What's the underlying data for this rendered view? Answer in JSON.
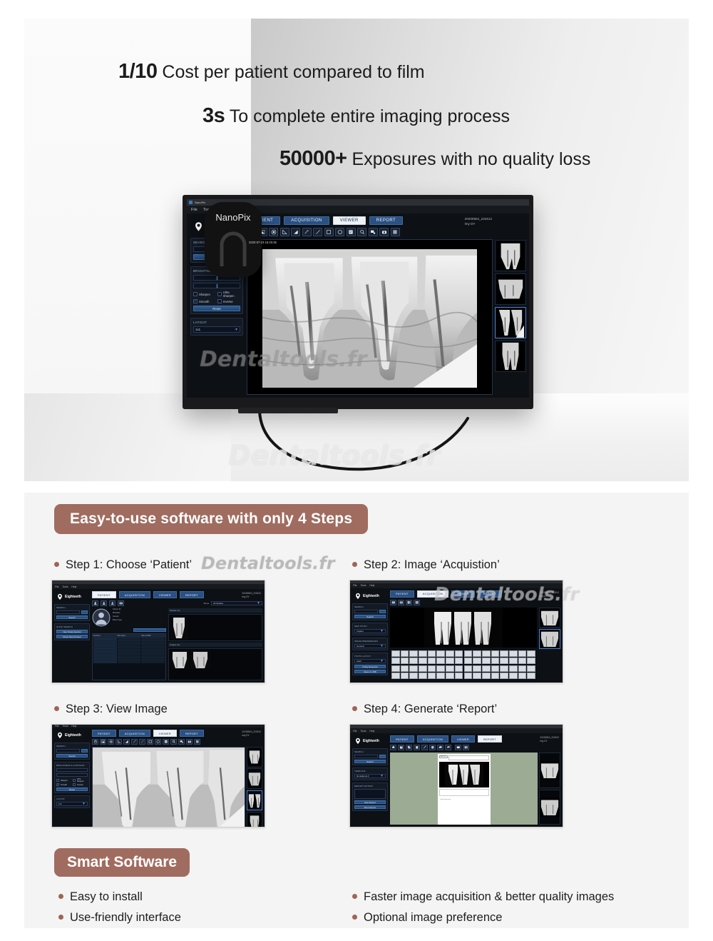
{
  "hero": {
    "stats": [
      {
        "number": "1/10",
        "text": "Cost per patient compared to film"
      },
      {
        "number": "3s",
        "text": "To complete entire imaging process"
      },
      {
        "number": "50000+",
        "text": "Exposures with no quality loss"
      }
    ],
    "sensor_label": "NanoPix",
    "watermark": "Dentaltools.fr"
  },
  "app": {
    "window_title": "NanoPix",
    "menus": [
      "File",
      "Tools",
      "Help"
    ],
    "brand": "Eighteeth",
    "tabs": [
      {
        "label": "PATIENT",
        "active": false
      },
      {
        "label": "ACQUISITION",
        "active": false
      },
      {
        "label": "VIEWER",
        "active": true
      },
      {
        "label": "REPORT",
        "active": false
      }
    ],
    "header_id": "20200804_222612",
    "header_sub": "lmy DY",
    "image_timestamp": "2020-07-23 15:20:35",
    "toolbar_icons": [
      "hand-icon",
      "contrast-icon",
      "brightness-icon",
      "angle-icon",
      "triangle-icon",
      "pen-icon",
      "line-icon",
      "rectangle-icon",
      "ellipse-icon",
      "note-icon",
      "magnifier-icon",
      "stamp-icon",
      "camera-icon",
      "grid-icon"
    ],
    "panels": {
      "search": {
        "title": "SEARCH",
        "input_value": "",
        "dropdown_label": "▾",
        "button": "Search"
      },
      "brightness": {
        "title": "BRIGHTNESS & CONTRAST",
        "checkboxes": [
          {
            "label": "Sharpen",
            "checked": false
          },
          {
            "label": "Ultra Sharpen",
            "checked": false
          },
          {
            "label": "Smooth",
            "checked": true
          },
          {
            "label": "Inverse",
            "checked": false
          }
        ],
        "reset": "Reset"
      },
      "layout": {
        "title": "LAYOUT",
        "value": "1x1"
      }
    }
  },
  "steps_section": {
    "heading": "Easy-to-use software with only 4 Steps",
    "steps": [
      {
        "label": "Step 1: Choose ‘Patient’",
        "active_tab": "PATIENT"
      },
      {
        "label": "Step 2: Image ‘Acquistion’",
        "active_tab": "ACQUISITION"
      },
      {
        "label": "Step 3: View Image",
        "active_tab": "VIEWER"
      },
      {
        "label": "Step 4: Generate ‘Report’",
        "active_tab": "REPORT"
      }
    ]
  },
  "step1": {
    "panels": [
      {
        "title": "SEARCH",
        "button": "Search"
      },
      {
        "title": "QUICK SEARCH",
        "buttons": [
          "New Study Appoint",
          "Show New Present"
        ]
      }
    ],
    "filter_label": "Show",
    "filter_value": "All Studies",
    "info_labels": [
      "Patient ID",
      "Birthdate",
      "Gender",
      "Blood Type",
      "Date of Birth"
    ],
    "table_headers": [
      "Surname",
      "First name",
      "Date of Birth"
    ],
    "studies_title": "Studies List",
    "images_title": "Images List"
  },
  "step2": {
    "panels": [
      {
        "title": "SEARCH",
        "button": "Search"
      },
      {
        "title": "NEW STUDY",
        "value": "Implant"
      },
      {
        "title": "IMAGE PREFERENCES",
        "value": "General"
      },
      {
        "title": "TOOTH LAYOUT",
        "value": "Adult"
      }
    ],
    "buttons": [
      "X-Ray Exposure",
      "Save to USB"
    ],
    "toolbar_icons": [
      "import-icon",
      "export-icon",
      "split-view-icon",
      "layout-icon"
    ]
  },
  "step4": {
    "panels": [
      {
        "title": "SEARCH",
        "button": "Search"
      },
      {
        "title": "TEMPLATE",
        "value": "Dentaltools.fr"
      },
      {
        "title": "REPORT HISTORY",
        "buttons": [
          "New Report",
          "Save Report"
        ]
      }
    ],
    "report_title": "REPORT",
    "report_note": "Dental report note",
    "toolbar_icons": [
      "print-icon",
      "save-icon",
      "copy-icon",
      "paste-icon",
      "edit-icon",
      "color-icon",
      "cloud-icon",
      "undo-icon",
      "page-icon",
      "grid-icon"
    ]
  },
  "smart": {
    "heading": "Smart Software",
    "features_left": [
      "Easy to install",
      "Use-friendly interface"
    ],
    "features_right": [
      "Faster image acquisition & better quality images",
      "Optional image preference"
    ]
  },
  "colors": {
    "ribbon": "#a06c60",
    "bullet": "#9d6558",
    "accent_blue": "#2b5082",
    "tab_active_bg": "#eef2f7"
  }
}
